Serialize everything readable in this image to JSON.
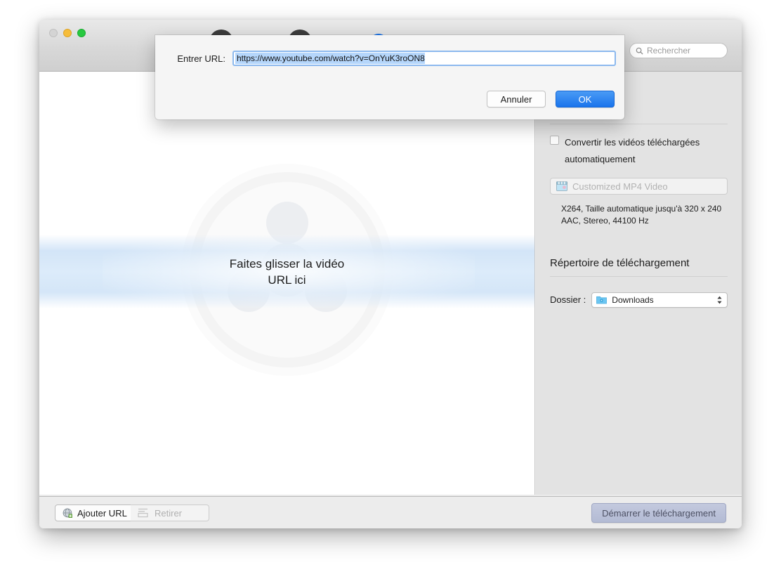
{
  "window": {
    "traffic_lights": [
      {
        "name": "close",
        "color": "#d4d4d4"
      },
      {
        "name": "minimize",
        "color": "#f6bd3b"
      },
      {
        "name": "zoom",
        "color": "#28c940"
      }
    ],
    "search": {
      "placeholder": "Rechercher",
      "icon": "search-icon"
    },
    "toolbar_icons": [
      "toolbar-icon-1",
      "toolbar-icon-2",
      "toolbar-icon-3-selected",
      "toolbar-icon-4-settings"
    ]
  },
  "dropzone": {
    "line1": "Faites glisser la vidéo",
    "line2": "URL ici",
    "watermark": "film-reel-watermark"
  },
  "sidebar": {
    "convert": {
      "checkbox_checked": false,
      "label_line1": "Convertir les vidéos téléchargées",
      "label_line2": "automatiquement"
    },
    "format_popup": {
      "icon": "clapperboard-icon",
      "value": "Customized MP4 Video"
    },
    "format_info_line1": "X264, Taille automatique jusqu'à 320 x 240",
    "format_info_line2": "AAC, Stereo, 44100 Hz",
    "directory_section_title": "Répertoire de téléchargement",
    "folder": {
      "label": "Dossier :",
      "icon": "folder-icon",
      "value": "Downloads"
    }
  },
  "bottom_bar": {
    "add_url_label": "Ajouter URL",
    "add_url_icon": "globe-icon",
    "remove_label": "Retirer",
    "remove_icon": "list-icon",
    "start_download_label": "Démarrer le téléchargement"
  },
  "sheet": {
    "label": "Entrer URL:",
    "url_value": "https://www.youtube.com/watch?v=OnYuK3roON8",
    "cancel_label": "Annuler",
    "ok_label": "OK",
    "accent_color": "#1a74ec",
    "selection_color": "#b5d6fb"
  }
}
